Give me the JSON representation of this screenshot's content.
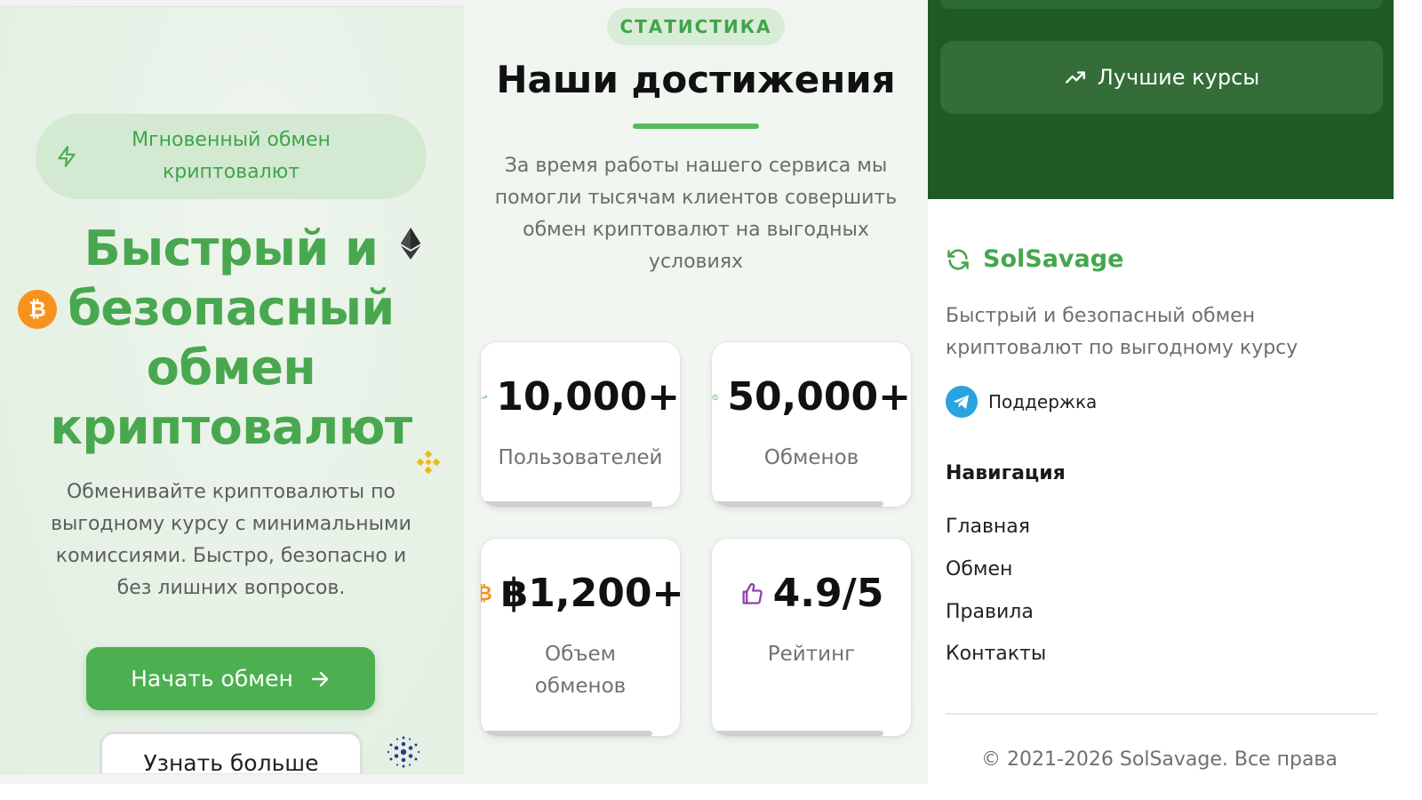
{
  "hero": {
    "badge": "Мгновенный обмен криптовалют",
    "title": "Быстрый и безопасный обмен криптовалют",
    "description": "Обменивайте криптовалюты по выгодному курсу с минимальными комиссиями. Быстро, безопасно и без лишних вопросов.",
    "start_button": "Начать обмен",
    "more_button": "Узнать больше"
  },
  "stats": {
    "tag": "СТАТИСТИКА",
    "title": "Наши достижения",
    "description": "За время работы нашего сервиса мы помогли тысячам клиентов совершить обмен криптовалют на выгодных условиях",
    "cards": [
      {
        "value": "10,000+",
        "label": "Пользователей",
        "icon": "trending-up-icon"
      },
      {
        "value": "50,000+",
        "label": "Обменов",
        "icon": "check-circle-icon"
      },
      {
        "value": "฿1,200+",
        "label": "Объем обменов",
        "icon": "bitcoin-icon"
      },
      {
        "value": "4.9/5",
        "label": "Рейтинг",
        "icon": "thumbs-up-icon"
      }
    ]
  },
  "footer": {
    "rates_button": "Лучшие курсы",
    "brand": "SolSavage",
    "brand_description": "Быстрый и безопасный обмен криптовалют по выгодному курсу",
    "support": "Поддержка",
    "nav_title": "Навигация",
    "nav": [
      "Главная",
      "Обмен",
      "Правила",
      "Контакты"
    ],
    "copyright": "© 2021-2026 SolSavage. Все права"
  },
  "colors": {
    "accent": "#4caf50",
    "accent_text": "#49a84f",
    "dark_green": "#1f5a24",
    "button_green": "#346d38"
  }
}
